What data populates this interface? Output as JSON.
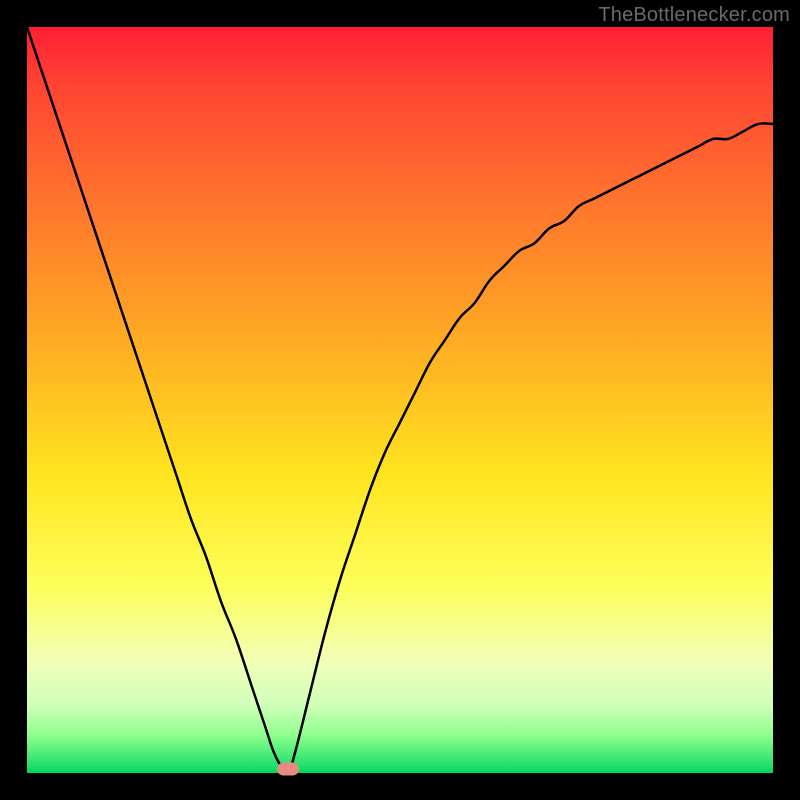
{
  "attribution": "TheBottlenecker.com",
  "colors": {
    "frame": "#000000",
    "gradient_top": "#ff1f33",
    "gradient_bottom": "#00d660",
    "curve": "#000000",
    "min_marker": "#e88a82"
  },
  "chart_data": {
    "type": "line",
    "title": "",
    "xlabel": "",
    "ylabel": "",
    "xlim": [
      0,
      100
    ],
    "ylim": [
      0,
      100
    ],
    "annotations": [
      "TheBottlenecker.com"
    ],
    "x": [
      0,
      2,
      4,
      6,
      8,
      10,
      12,
      14,
      16,
      18,
      20,
      22,
      24,
      26,
      28,
      30,
      31,
      32,
      33,
      34,
      35,
      36,
      38,
      40,
      42,
      44,
      46,
      48,
      50,
      52,
      54,
      56,
      58,
      60,
      62,
      64,
      66,
      68,
      70,
      72,
      74,
      76,
      78,
      80,
      82,
      84,
      86,
      88,
      90,
      92,
      94,
      96,
      98,
      100
    ],
    "values": [
      100,
      94,
      88,
      82,
      76,
      70,
      64,
      58,
      52,
      46,
      40,
      34,
      29,
      23,
      18,
      12,
      9,
      6,
      3,
      1,
      0,
      3,
      11,
      19,
      26,
      32,
      38,
      43,
      47,
      51,
      55,
      58,
      61,
      63,
      66,
      68,
      70,
      71,
      73,
      74,
      76,
      77,
      78,
      79,
      80,
      81,
      82,
      83,
      84,
      85,
      85,
      86,
      87,
      87
    ],
    "minimum": {
      "x": 35,
      "y": 0
    }
  }
}
